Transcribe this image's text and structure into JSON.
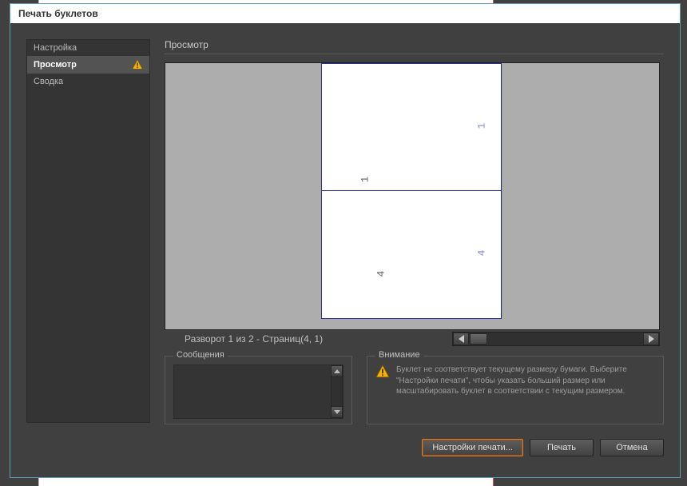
{
  "dialog": {
    "title": "Печать буклетов"
  },
  "sidebar": {
    "items": [
      {
        "label": "Настройка",
        "selected": false,
        "warning": false
      },
      {
        "label": "Просмотр",
        "selected": true,
        "warning": true
      },
      {
        "label": "Сводка",
        "selected": false,
        "warning": false
      }
    ]
  },
  "preview": {
    "heading": "Просмотр",
    "status": "Разворот 1 из 2 - Страниц(4, 1)",
    "top_page": {
      "right_num": "1",
      "left_num": "1"
    },
    "bottom_page": {
      "right_num": "4",
      "left_num": "4"
    }
  },
  "messages": {
    "heading": "Сообщения"
  },
  "attention": {
    "heading": "Внимание",
    "text": "Буклет не соответствует текущему размеру бумаги. Выберите \"Настройки печати\", чтобы указать больший размер или масштабировать буклет в соответствии с текущим размером."
  },
  "buttons": {
    "print_settings": "Настройки печати...",
    "print": "Печать",
    "cancel": "Отмена"
  }
}
